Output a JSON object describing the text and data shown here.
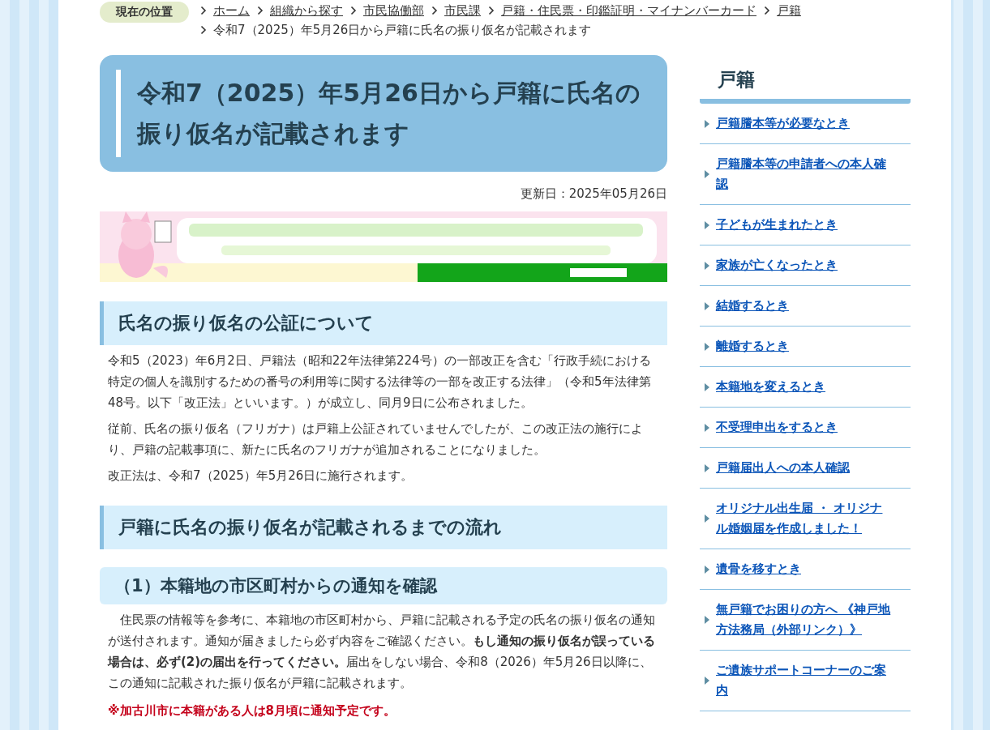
{
  "breadcrumb": {
    "label": "現在の位置",
    "items": [
      {
        "text": "ホーム",
        "link": true
      },
      {
        "text": "組織から探す",
        "link": true
      },
      {
        "text": "市民協働部",
        "link": true
      },
      {
        "text": "市民課",
        "link": true
      },
      {
        "text": "戸籍・住民票・印鑑証明・マイナンバーカード",
        "link": true
      },
      {
        "text": "戸籍",
        "link": true
      },
      {
        "text": "令和7（2025）年5月26日から戸籍に氏名の振り仮名が記載されます",
        "link": false
      }
    ]
  },
  "title": "令和7（2025）年5月26日から戸籍に氏名の振り仮名が記載されます",
  "updated": "更新日：2025年05月26日",
  "content": [
    {
      "kind": "h2",
      "text": "氏名の振り仮名の公証について"
    },
    {
      "kind": "p",
      "text": "令和5（2023）年6月2日、戸籍法（昭和22年法律第224号）の一部改正を含む「行政手続における特定の個人を識別するための番号の利用等に関する法律等の一部を改正する法律」（令和5年法律第48号。以下「改正法」といいます。）が成立し、同月9日に公布されました。"
    },
    {
      "kind": "p",
      "text": "従前、氏名の振り仮名（フリガナ）は戸籍上公証されていませんでしたが、この改正法の施行により、戸籍の記載事項に、新たに氏名のフリガナが追加されることになりました。"
    },
    {
      "kind": "p",
      "text": "改正法は、令和7（2025）年5月26日に施行されます。"
    },
    {
      "kind": "h2",
      "text": "戸籍に氏名の振り仮名が記載されるまでの流れ"
    },
    {
      "kind": "h3",
      "text": "（1）本籍地の市区町村からの通知を確認"
    },
    {
      "kind": "p",
      "text": "　住民票の情報等を参考に、本籍地の市区町村から、戸籍に記載される予定の氏名の振り仮名の通知が送付されます。通知が届きましたら必ず内容をご確認ください。**もし通知の振り仮名が誤っている場合は、必ず(2)の届出を行ってください。**届出をしない場合、令和8（2026）年5月26日以降に、この通知に記載された振り仮名が戸籍に記載されます。"
    },
    {
      "kind": "note",
      "text": "※加古川市に本籍がある人は8月頃に通知予定です。"
    }
  ],
  "sidebar": {
    "title": "戸籍",
    "items": [
      "戸籍謄本等が必要なとき",
      "戸籍謄本等の申請者への本人確認",
      "子どもが生まれたとき",
      "家族が亡くなったとき",
      "結婚するとき",
      "離婚するとき",
      "本籍地を変えるとき",
      "不受理申出をするとき",
      "戸籍届出人への本人確認",
      "オリジナル出生届 ・ オリジナル婚姻届を作成しました！",
      "遺骨を移すとき",
      "無戸籍でお困りの方へ 《神戸地方法務局（外部リンク）》",
      "ご遺族サポートコーナーのご案内"
    ]
  }
}
